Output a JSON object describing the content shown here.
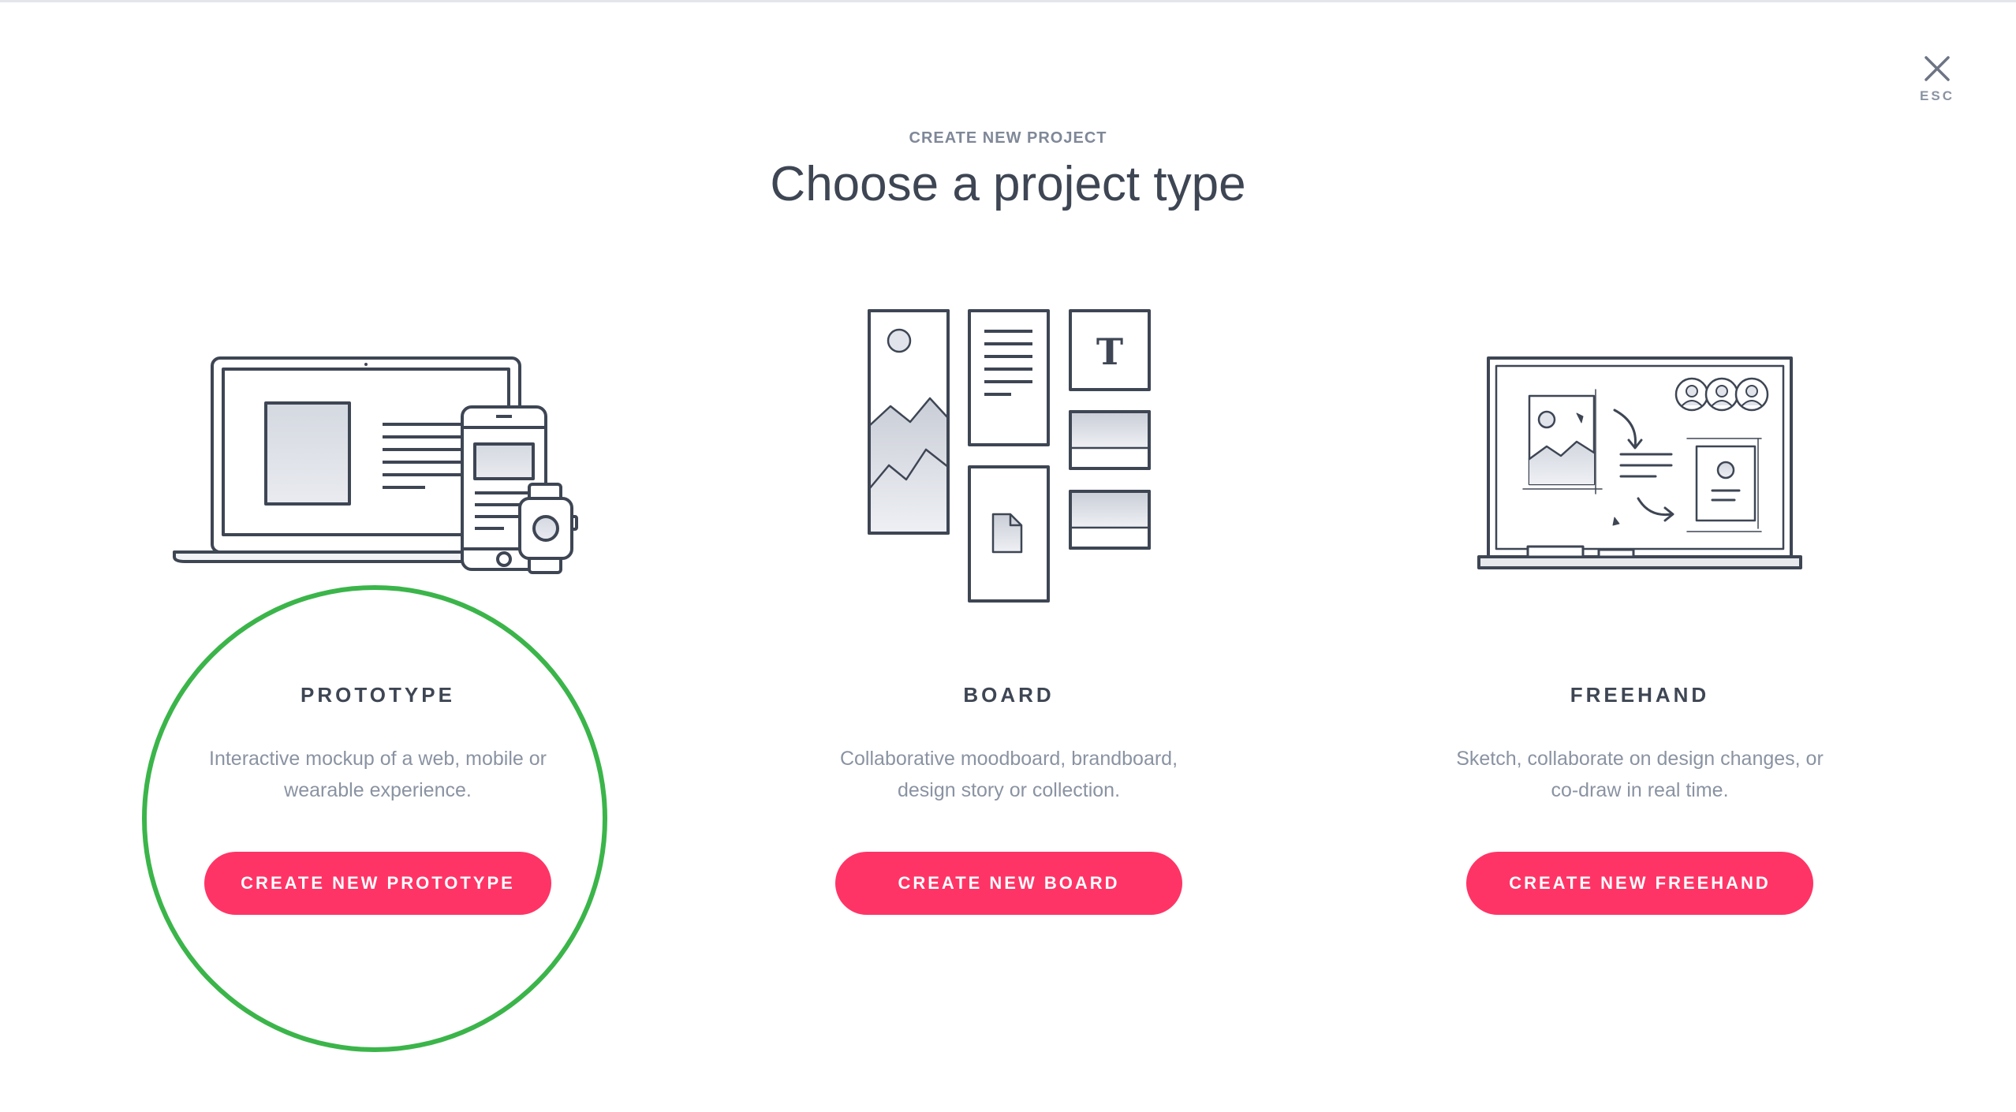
{
  "header": {
    "eyebrow": "CREATE NEW PROJECT",
    "title": "Choose a project type"
  },
  "close": {
    "label": "ESC",
    "icon": "close-icon"
  },
  "colors": {
    "accent": "#ff3466",
    "highlight": "#3bb54a",
    "text": "#3e4654",
    "muted": "#8a93a2"
  },
  "project_types": [
    {
      "title": "PROTOTYPE",
      "description": "Interactive mockup of a web, mobile or wearable experience.",
      "button": "CREATE NEW PROTOTYPE",
      "icon": "devices-illustration"
    },
    {
      "title": "BOARD",
      "description": "Collaborative moodboard, brandboard, design story or collection.",
      "button": "CREATE NEW BOARD",
      "icon": "moodboard-illustration"
    },
    {
      "title": "FREEHAND",
      "description": "Sketch, collaborate on design changes, or co-draw in real time.",
      "button": "CREATE NEW FREEHAND",
      "icon": "whiteboard-illustration"
    }
  ]
}
